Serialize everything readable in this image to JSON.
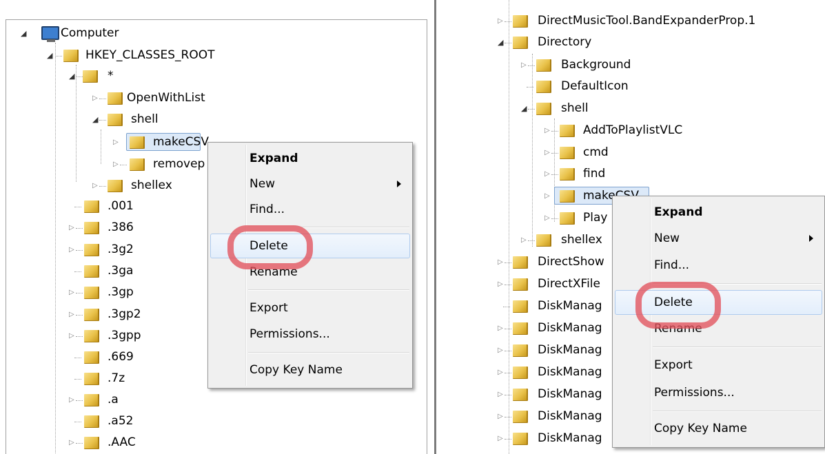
{
  "left": {
    "tree": {
      "root": "Computer",
      "hive": "HKEY_CLASSES_ROOT",
      "star": "*",
      "openwithlist": "OpenWithList",
      "shell": "shell",
      "makecsv": "makeCSV",
      "removep": "removep",
      "shellex": "shellex",
      "ext_001": ".001",
      "ext_386": ".386",
      "ext_3g2": ".3g2",
      "ext_3ga": ".3ga",
      "ext_3gp": ".3gp",
      "ext_3gp2": ".3gp2",
      "ext_3gpp": ".3gpp",
      "ext_669": ".669",
      "ext_7z": ".7z",
      "ext_a": ".a",
      "ext_a52": ".a52",
      "ext_aac": ".AAC"
    },
    "menu": {
      "expand": "Expand",
      "new": "New",
      "find": "Find...",
      "delete": "Delete",
      "rename": "Rename",
      "export": "Export",
      "permissions": "Permissions...",
      "copy_key_name": "Copy Key Name"
    }
  },
  "right": {
    "tree": {
      "bandexpander": "DirectMusicTool.BandExpanderProp.1",
      "directory": "Directory",
      "background": "Background",
      "defaulticon": "DefaultIcon",
      "shell": "shell",
      "addtoplaylist": "AddToPlaylistVLC",
      "cmd": "cmd",
      "find": "find",
      "makecsv": "makeCSV",
      "play": "Play",
      "shellex": "shellex",
      "directshow": "DirectShow",
      "directxfile": "DirectXFile",
      "diskmanag1": "DiskManag",
      "diskmanag2": "DiskManag",
      "diskmanag3": "DiskManag",
      "diskmanag4": "DiskManag",
      "diskmanag5": "DiskManag",
      "diskmanag6": "DiskManag",
      "diskmanag7": "DiskManag"
    },
    "menu": {
      "expand": "Expand",
      "new": "New",
      "find": "Find...",
      "delete": "Delete",
      "rename": "Rename",
      "export": "Export",
      "permissions": "Permissions...",
      "copy_key_name": "Copy Key Name"
    }
  },
  "colors": {
    "highlight_circle": "#e2525c",
    "selection": "#dce9f8",
    "menu_bg": "#f0f0f0"
  }
}
